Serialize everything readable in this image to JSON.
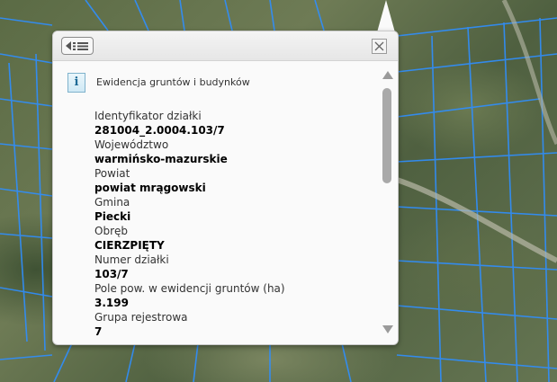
{
  "map": {
    "description_icon": "aerial-map"
  },
  "popup": {
    "back_icon": "list-back-icon",
    "close_icon": "close-icon",
    "section_title": "Ewidencja gruntów i budynków",
    "fields": [
      {
        "label": "Identyfikator działki",
        "value": "281004_2.0004.103/7"
      },
      {
        "label": "Województwo",
        "value": "warmińsko-mazurskie"
      },
      {
        "label": "Powiat",
        "value": "powiat mrągowski"
      },
      {
        "label": "Gmina",
        "value": "Piecki"
      },
      {
        "label": "Obręb",
        "value": "CIERZPIĘTY"
      },
      {
        "label": "Numer działki",
        "value": "103/7"
      },
      {
        "label": "Pole pow. w ewidencji gruntów (ha)",
        "value": "3.199"
      },
      {
        "label": "Grupa rejestrowa",
        "value": "7"
      }
    ]
  },
  "colors": {
    "parcel_lines": "#2f8fff",
    "popup_bg": "#fafafa"
  }
}
